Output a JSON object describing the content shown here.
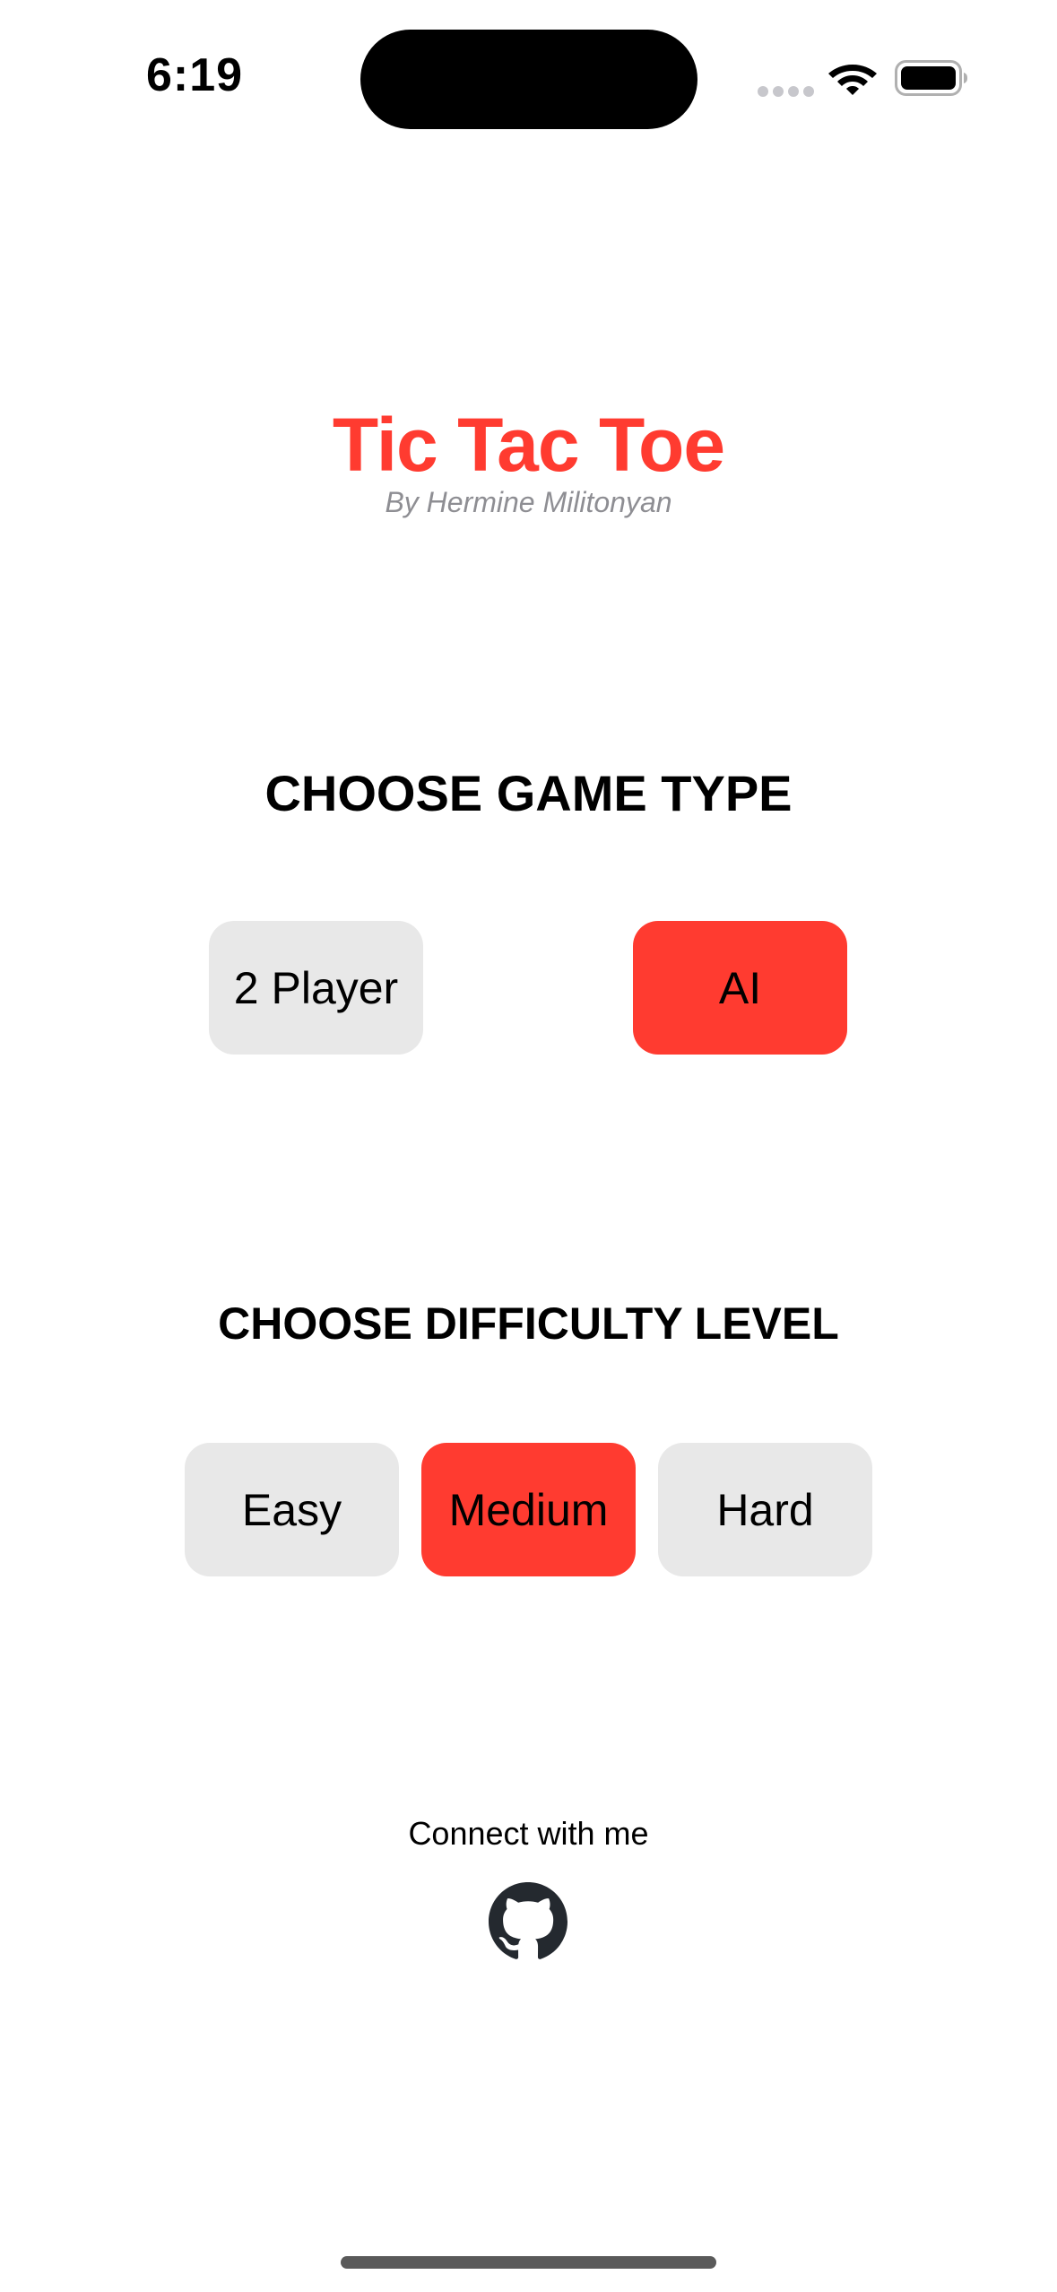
{
  "status_bar": {
    "time": "6:19",
    "icons": [
      "signal-dots-icon",
      "wifi-icon",
      "battery-icon"
    ]
  },
  "header": {
    "title": "Tic Tac Toe",
    "subtitle": "By Hermine Militonyan"
  },
  "game_type": {
    "heading": "CHOOSE GAME TYPE",
    "options": [
      {
        "label": "2 Player",
        "selected": false
      },
      {
        "label": "AI",
        "selected": true
      }
    ]
  },
  "difficulty": {
    "heading": "CHOOSE DIFFICULTY LEVEL",
    "options": [
      {
        "label": "Easy",
        "selected": false
      },
      {
        "label": "Medium",
        "selected": true
      },
      {
        "label": "Hard",
        "selected": false
      }
    ]
  },
  "footer": {
    "connect_label": "Connect with me",
    "link_icon": "github-icon"
  },
  "colors": {
    "accent": "#ff3b30",
    "button_bg": "#e8e8e8",
    "subtitle": "#8e8e93"
  }
}
